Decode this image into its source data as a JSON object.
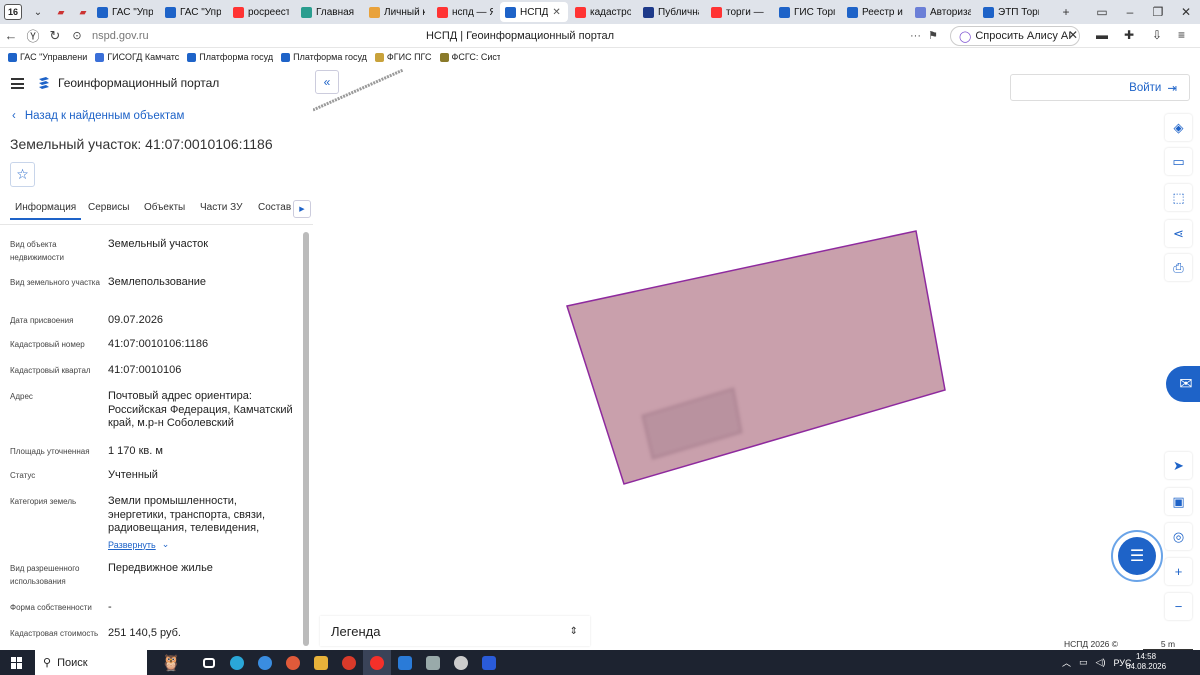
{
  "browser": {
    "tab_counter": "16",
    "tabs": [
      {
        "label": "ГАС \"Упра",
        "color": "#1e63c8"
      },
      {
        "label": "ГАС \"Упр",
        "color": "#1e63c8"
      },
      {
        "label": "росреест",
        "color": "#f33"
      },
      {
        "label": "Главная с",
        "color": "#2a9d8f"
      },
      {
        "label": "Личный к",
        "color": "#e9a23b"
      },
      {
        "label": "нспд — Я",
        "color": "#f33"
      },
      {
        "label": "НСПД",
        "color": "#1e63c8",
        "active": true
      },
      {
        "label": "кадастро",
        "color": "#f33"
      },
      {
        "label": "Публична",
        "color": "#1e3a8a"
      },
      {
        "label": "торги — Я",
        "color": "#f33"
      },
      {
        "label": "ГИС Торг",
        "color": "#1e63c8"
      },
      {
        "label": "Реестр из",
        "color": "#1e63c8"
      },
      {
        "label": "Авториза",
        "color": "#6b7fd7"
      },
      {
        "label": "ЭТП Торг",
        "color": "#1e63c8"
      }
    ],
    "url": "nspd.gov.ru",
    "page_title": "НСПД | Геоинформационный портал",
    "alice_label": "Спросить Алису AI",
    "bookmarks": [
      {
        "label": "ГАС \"Управлени",
        "color": "#1e63c8"
      },
      {
        "label": "ГИСОГД Камчатс",
        "color": "#3a6fd8"
      },
      {
        "label": "Платформа госуд",
        "color": "#1e63c8"
      },
      {
        "label": "Платформа госуд",
        "color": "#1e63c8"
      },
      {
        "label": "ФГИС ПГС",
        "color": "#c8a23b"
      },
      {
        "label": "ФСГС: Система с",
        "color": "#8a7a2a"
      }
    ]
  },
  "panel": {
    "app_title": "Геоинформационный портал",
    "back_label": "Назад к найденным объектам",
    "object_title": "Земельный участок: 41:07:0010106:1186",
    "tabs": [
      "Информация",
      "Сервисы",
      "Объекты",
      "Части ЗУ",
      "Состав"
    ],
    "fields": [
      {
        "key": "Вид объекта недвижимости",
        "value": "Земельный участок"
      },
      {
        "key": "Вид земельного участка",
        "value": "Землепользование"
      },
      {
        "key": "Дата присвоения",
        "value": "09.07.2026"
      },
      {
        "key": "Кадастровый номер",
        "value": "41:07:0010106:1186"
      },
      {
        "key": "Кадастровый квартал",
        "value": "41:07:0010106"
      },
      {
        "key": "Адрес",
        "value": "Почтовый адрес ориентира: Российская Федерация, Камчатский край, м.р-н Соболевский"
      },
      {
        "key": "Площадь уточненная",
        "value": "1 170 кв. м"
      },
      {
        "key": "Статус",
        "value": "Учтенный"
      },
      {
        "key": "Категория земель",
        "value": "Земли промышленности, энергетики, транспорта, связи, радиовещания, телевидения,"
      },
      {
        "key": "Вид разрешенного использования",
        "value": "Передвижное жилье"
      },
      {
        "key": "Форма собственности",
        "value": "-"
      },
      {
        "key": "Кадастровая стоимость",
        "value": "251 140,5 руб."
      }
    ],
    "expand_label": "Развернуть"
  },
  "map": {
    "login_label": "Войти",
    "legend_label": "Легенда",
    "copyright": "НСПД 2026 ©",
    "scale": "5 m",
    "parcel_fill": "#c9a0ac",
    "parcel_stroke": "#8e2a9e"
  },
  "taskbar": {
    "search_label": "Поиск",
    "lang": "РУС",
    "time": "14:58",
    "date": "04.08.2026"
  }
}
